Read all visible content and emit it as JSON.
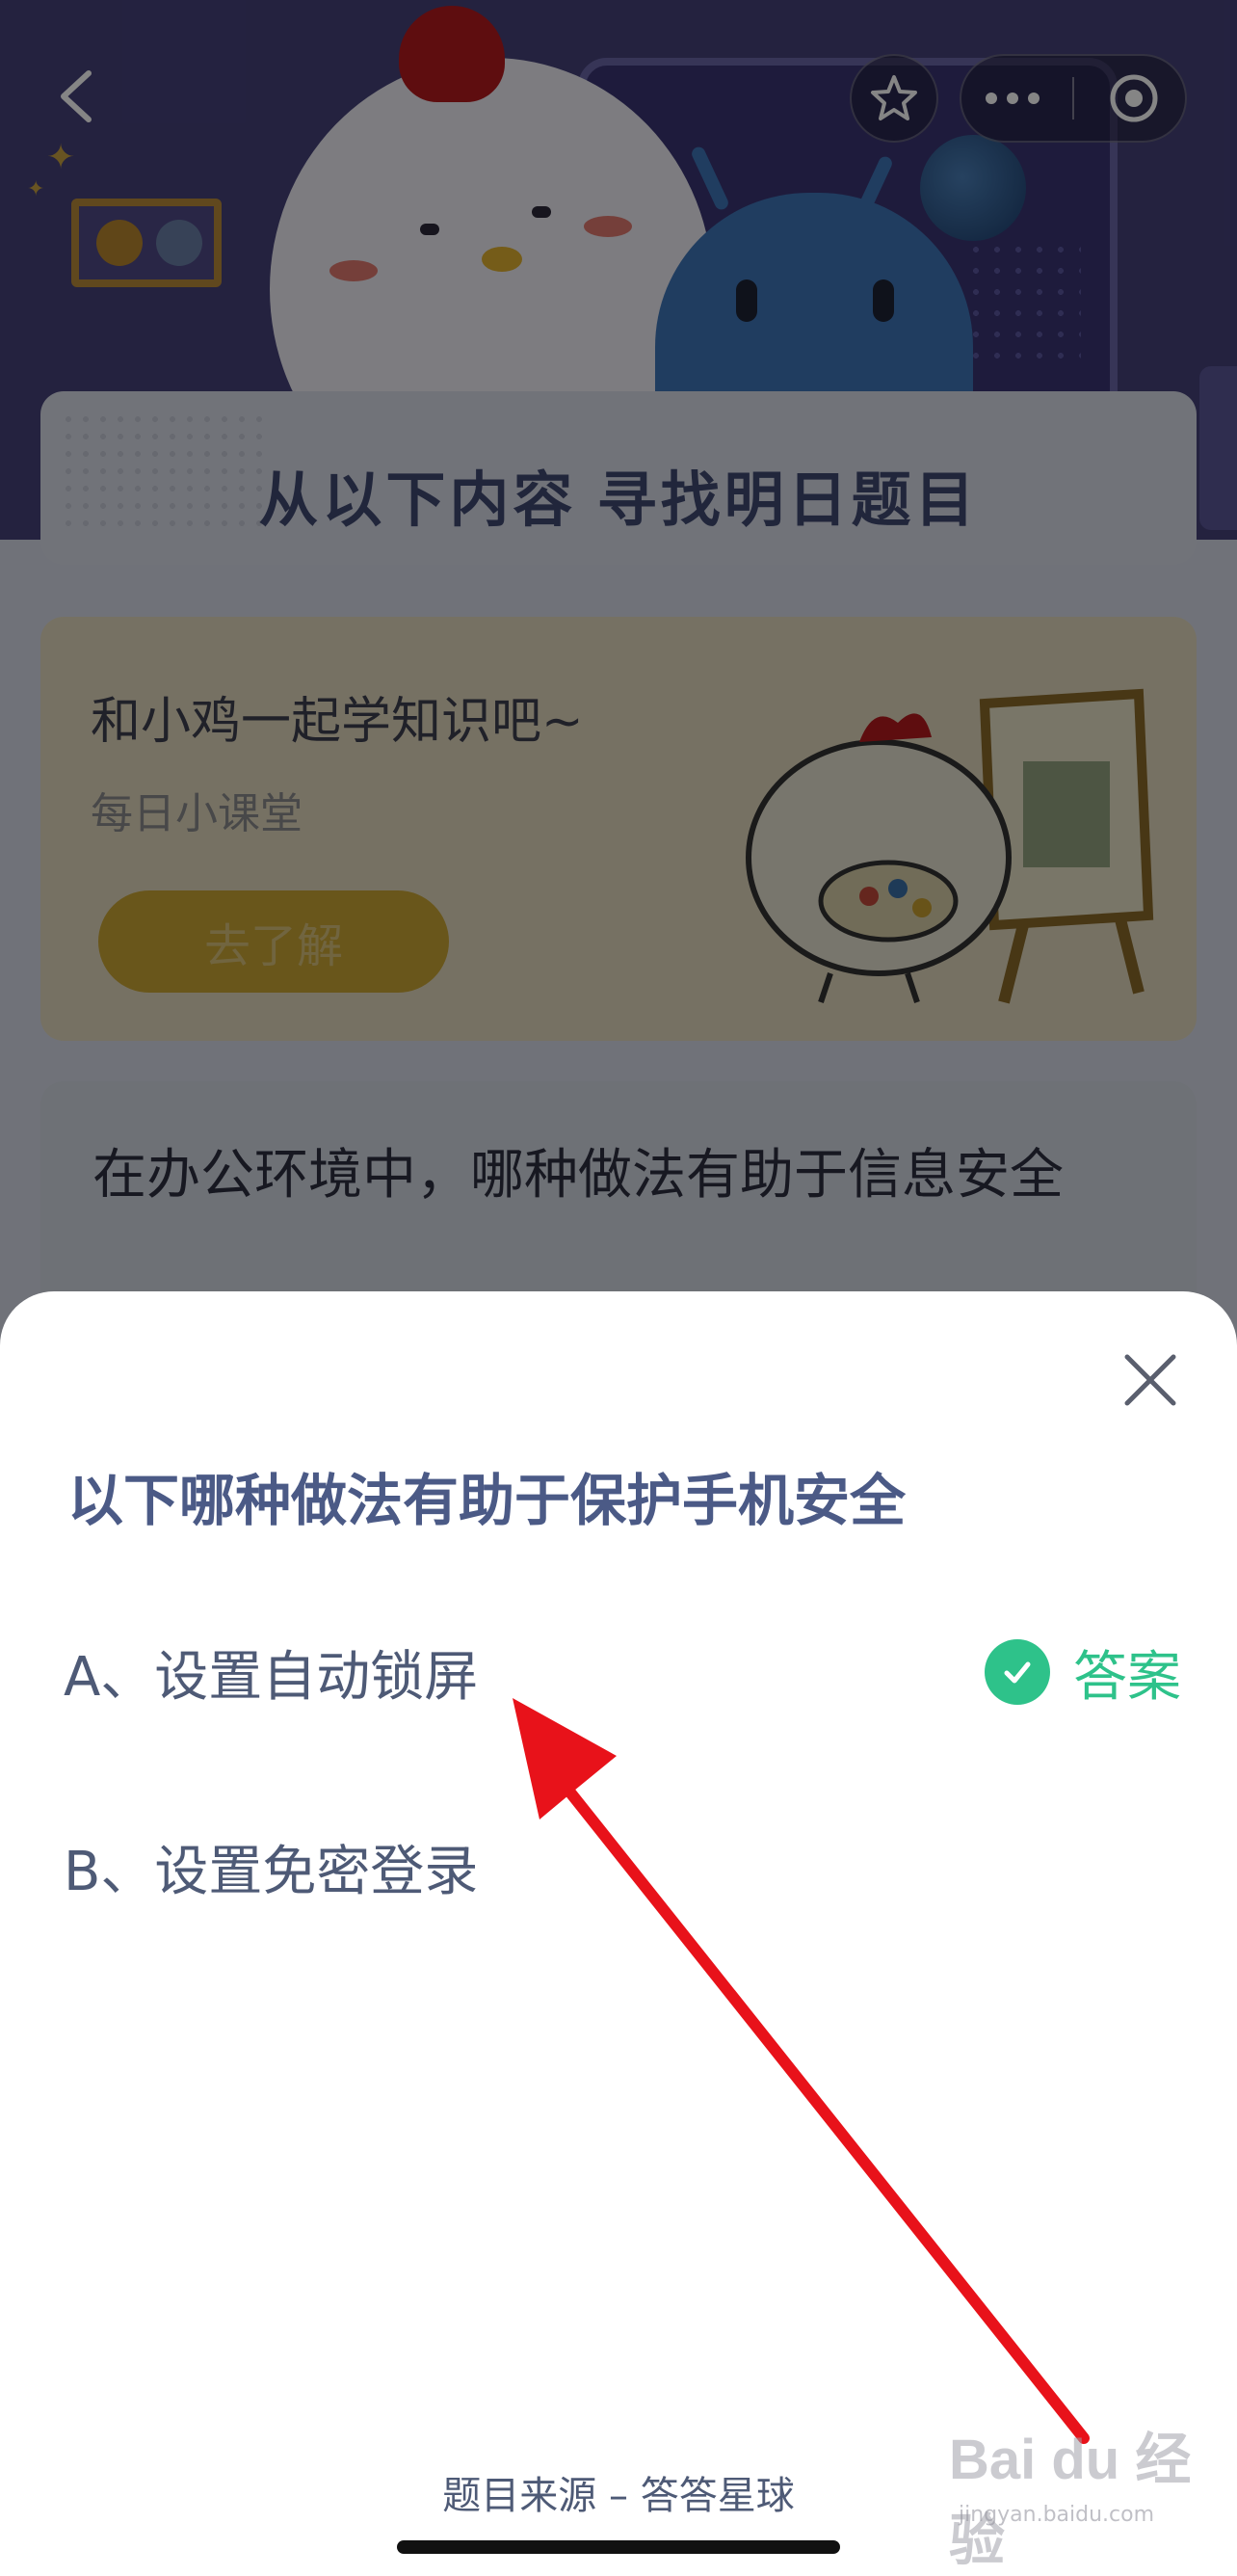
{
  "nav": {
    "back_icon": "chevron-left-icon",
    "favorite_icon": "star-icon",
    "more_icon": "more-dots-icon",
    "close_miniapp_icon": "target-icon"
  },
  "hero": {
    "find_title": "从以下内容 寻找明日题目"
  },
  "learn_card": {
    "title": "和小鸡一起学知识吧~",
    "subtitle": "每日小课堂",
    "button_label": "去了解"
  },
  "question_card": {
    "text": "在办公环境中，哪种做法有助于信息安全"
  },
  "sheet": {
    "close_icon": "close-icon",
    "title": "以下哪种做法有助于保护手机安全",
    "options": [
      {
        "label": "A、设置自动锁屏",
        "is_answer": true
      },
      {
        "label": "B、设置免密登录",
        "is_answer": false
      }
    ],
    "answer_label": "答案",
    "source": "题目来源 – 答答星球"
  },
  "watermark": {
    "main": "Bai du 经验",
    "sub": "jingyan.baidu.com"
  },
  "colors": {
    "accent_green": "#2ec28a",
    "title_blue": "#4b5a86",
    "annotation_red": "#e8121a"
  }
}
